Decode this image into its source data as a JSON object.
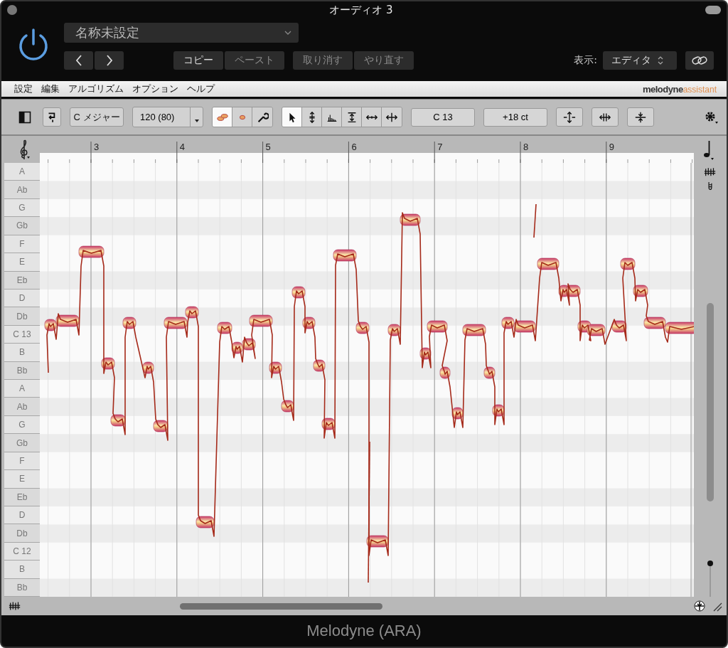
{
  "window": {
    "title": "オーディオ 3"
  },
  "preset": {
    "value": "名称未設定"
  },
  "edit_buttons": [
    {
      "label": "コピー",
      "disabled": false
    },
    {
      "label": "ペースト",
      "disabled": true
    },
    {
      "label": "取り消す",
      "disabled": true
    },
    {
      "label": "やり直す",
      "disabled": true
    }
  ],
  "view": {
    "label": "表示:",
    "value": "エディタ"
  },
  "menu": [
    "設定",
    "編集",
    "アルゴリズム",
    "オプション",
    "ヘルプ"
  ],
  "brand": {
    "name": "melodyne",
    "edition": "assistant"
  },
  "toolbar": {
    "scale": "C メジャー",
    "tempo": "120 (80)",
    "pitch_readout": "C 13",
    "cents_readout": "+18 ct",
    "main_tools": [
      {
        "kind": "notes",
        "selected": true
      },
      {
        "kind": "note",
        "selected": false
      },
      {
        "kind": "wrench",
        "selected": false
      }
    ],
    "edit_tools": [
      {
        "kind": "pointer",
        "selected": true
      },
      {
        "kind": "pitch",
        "selected": false
      },
      {
        "kind": "amplitude",
        "selected": false
      },
      {
        "kind": "formant",
        "selected": false
      },
      {
        "kind": "time",
        "selected": false
      },
      {
        "kind": "split",
        "selected": false
      }
    ]
  },
  "ruler": [
    "3",
    "4",
    "5",
    "6",
    "7",
    "8",
    "9"
  ],
  "keys": [
    {
      "label": "A",
      "black": false
    },
    {
      "label": "Ab",
      "black": true
    },
    {
      "label": "G",
      "black": false
    },
    {
      "label": "Gb",
      "black": true
    },
    {
      "label": "F",
      "black": false
    },
    {
      "label": "E",
      "black": false
    },
    {
      "label": "Eb",
      "black": true
    },
    {
      "label": "D",
      "black": false
    },
    {
      "label": "Db",
      "black": true
    },
    {
      "label": "C 13",
      "black": false
    },
    {
      "label": "B",
      "black": false
    },
    {
      "label": "Bb",
      "black": true
    },
    {
      "label": "A",
      "black": false
    },
    {
      "label": "Ab",
      "black": true
    },
    {
      "label": "G",
      "black": false
    },
    {
      "label": "Gb",
      "black": true
    },
    {
      "label": "F",
      "black": false
    },
    {
      "label": "E",
      "black": false
    },
    {
      "label": "Eb",
      "black": true
    },
    {
      "label": "D",
      "black": false
    },
    {
      "label": "Db",
      "black": true
    },
    {
      "label": "C 12",
      "black": false
    },
    {
      "label": "B",
      "black": false
    },
    {
      "label": "Bb",
      "black": true
    }
  ],
  "zoom_slider": {
    "level": 1
  },
  "footer": {
    "title": "Melodyne (ARA)"
  }
}
